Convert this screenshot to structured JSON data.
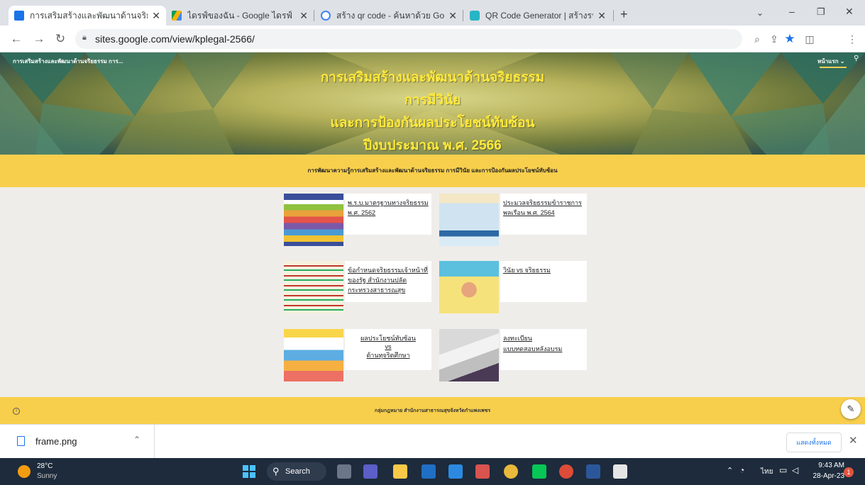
{
  "browser": {
    "tabs": [
      {
        "title": "การเสริมสร้างและพัฒนาด้านจริยธรรม",
        "icon": "google-sites-icon",
        "active": true
      },
      {
        "title": "ไดรฟ์ของฉัน - Google ไดรฟ์",
        "icon": "google-drive-icon",
        "active": false
      },
      {
        "title": "สร้าง qr code - ค้นหาด้วย Google",
        "icon": "google-icon",
        "active": false
      },
      {
        "title": "QR Code Generator | สร้างรหัส QR",
        "icon": "qr-generator-icon",
        "active": false
      }
    ],
    "new_tab_label": "+",
    "url": "sites.google.com/view/kplegal-2566/"
  },
  "site": {
    "site_name": "การเสริมสร้างและพัฒนาด้านจริยธรรม การ...",
    "nav_home": "หน้าแรก ⌄",
    "title_lines": [
      "การเสริมสร้างและพัฒนาด้านจริยธรรม",
      "การมีวินัย",
      "และการป้องกันผลประโยชน์ทับซ้อน",
      "ปีงบประมาณ พ.ศ. 2566"
    ],
    "subtitle": "การพัฒนาความรู้การเสริมสร้างและพัฒนาด้านจริยธรรม การมีวินัย และการป้องกันผลประโยชน์ทับซ้อน",
    "cards": [
      {
        "label": "พ.ร.บ.มาตรฐานทางจริยธรรม พ.ศ. 2562"
      },
      {
        "label": "ประมวลจริยธรรมข้าราชการพลเรือน พ.ศ. 2564"
      },
      {
        "label": "ข้อกำหนดจริยธรรมเจ้าหน้าที่ของรัฐ สำนักงานปลัดกระทรวงสาธารณสุข"
      },
      {
        "label": "วินัย vs จริยธรรม"
      },
      {
        "label": "ผลประโยชน์ทับซ้อน\nvs\nต้านทุจริตศึกษา"
      },
      {
        "label": "ลงทะเบียน\nแบบทดสอบหลังอบรม"
      }
    ],
    "footer": "กลุ่มกฎหมาย  สำนักงานสาธารณสุขจังหวัดกำแพงเพชร"
  },
  "downloads": {
    "file_name": "frame.png",
    "show_all": "แสดงทั้งหมด"
  },
  "taskbar": {
    "temperature": "28°C",
    "condition": "Sunny",
    "search_label": "Search",
    "language": "ไทย",
    "time": "9:43 AM",
    "date": "28-Apr-23",
    "notification_count": "1"
  },
  "colors": {
    "title_yellow": "#ffea3d",
    "banner_yellow": "#f8cf4c",
    "page_bg": "#efedea",
    "chrome_accent": "#1a73e8"
  }
}
